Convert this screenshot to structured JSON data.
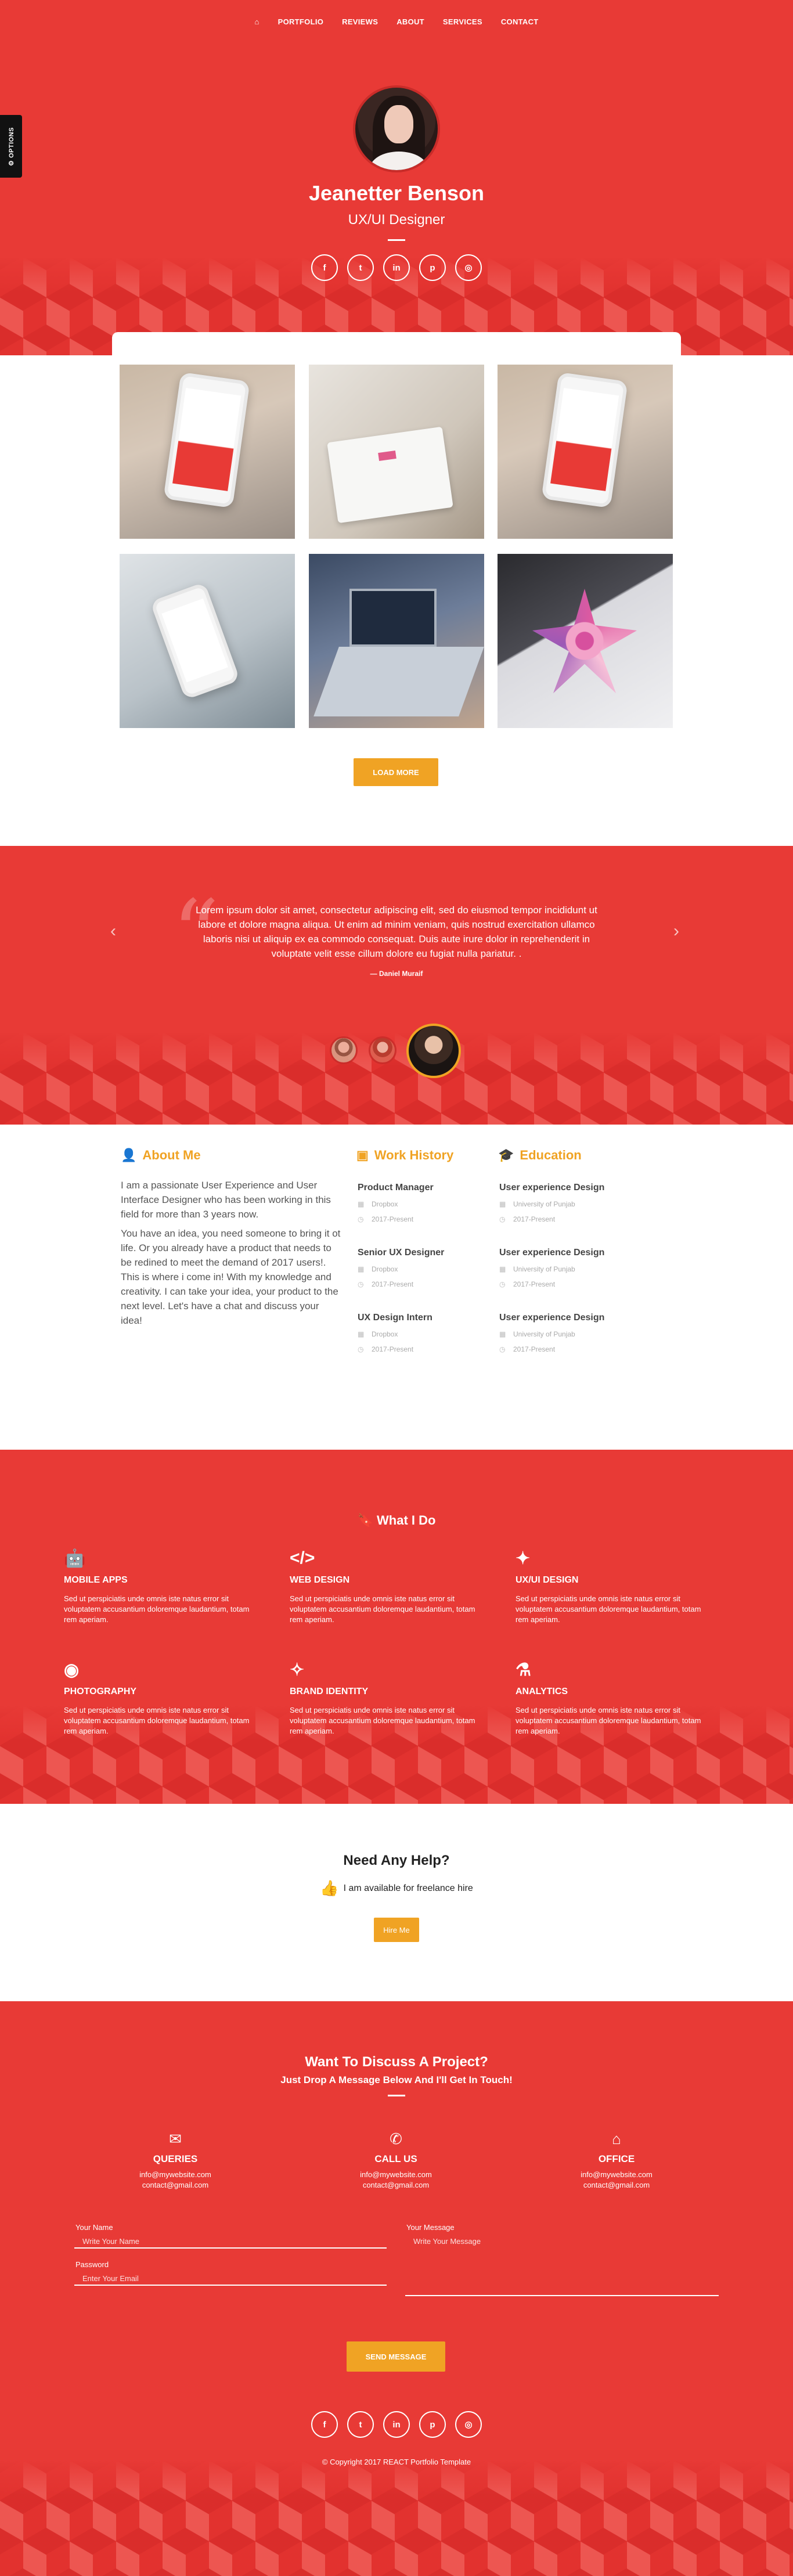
{
  "nav": {
    "home_icon": "home-icon",
    "items": [
      "PORTFOLIO",
      "REVIEWS",
      "ABOUT",
      "SERVICES",
      "CONTACT"
    ]
  },
  "options_tab": {
    "label": "OPTIONS",
    "icon": "gear-icon"
  },
  "hero": {
    "name": "Jeanetter Benson",
    "role": "UX/UI Designer",
    "socials": [
      {
        "icon": "facebook-icon",
        "glyph": "f"
      },
      {
        "icon": "twitter-icon",
        "glyph": "t"
      },
      {
        "icon": "linkedin-icon",
        "glyph": "in"
      },
      {
        "icon": "pinterest-icon",
        "glyph": "p"
      },
      {
        "icon": "instagram-icon",
        "glyph": "◎"
      }
    ]
  },
  "portfolio": {
    "tiles": [
      "mobile-app-screenshot",
      "tablet-sketch",
      "mobile-app-screenshot",
      "phone-in-hand",
      "laptop-workspace",
      "tablet-artwork"
    ],
    "load_more_label": "LOAD MORE"
  },
  "testimonial": {
    "quote": "Lorem ipsum dolor sit amet, consectetur adipiscing elit, sed do eiusmod tempor incididunt ut labore et dolore magna aliqua. Ut enim ad minim veniam, quis nostrud exercitation ullamco laboris nisi ut aliquip ex ea commodo consequat. Duis aute irure dolor in reprehenderit in voluptate velit esse cillum dolore eu fugiat nulla pariatur. .",
    "author": "— Daniel Muraif",
    "prev_icon": "chevron-left-icon",
    "next_icon": "chevron-right-icon"
  },
  "about": {
    "title": "About Me",
    "paragraphs": [
      "I am a passionate User Experience and User Interface Designer who has been working in this field for more than 3 years now.",
      "You have an idea, you need someone to bring it ot life. Or you already have a product that needs to be redined to meet the demand of 2017 users!. This is where i come in! With my knowledge and creativity. I can take your idea, your product to the next level. Let's have a chat and discuss your idea!"
    ]
  },
  "work_history": {
    "title": "Work History",
    "items": [
      {
        "title": "Product Manager",
        "company": "Dropbox",
        "period": "2017-Present"
      },
      {
        "title": "Senior UX Designer",
        "company": "Dropbox",
        "period": "2017-Present"
      },
      {
        "title": "UX Design Intern",
        "company": "Dropbox",
        "period": "2017-Present"
      }
    ]
  },
  "education": {
    "title": "Education",
    "items": [
      {
        "title": "User experience Design",
        "school": "University of Punjab",
        "period": "2017-Present"
      },
      {
        "title": "User experience Design",
        "school": "University of Punjab",
        "period": "2017-Present"
      },
      {
        "title": "User experience Design",
        "school": "University of Punjab",
        "period": "2017-Present"
      }
    ]
  },
  "services": {
    "title": "What I Do",
    "items": [
      {
        "icon": "android-icon",
        "glyph": "🤖",
        "name": "MOBILE APPS",
        "desc": "Sed ut perspiciatis unde omnis iste natus error sit voluptatem accusantium doloremque laudantium, totam rem aperiam."
      },
      {
        "icon": "code-icon",
        "glyph": "</>",
        "name": "WEB DESIGN",
        "desc": "Sed ut perspiciatis unde omnis iste natus error sit voluptatem accusantium doloremque laudantium, totam rem aperiam."
      },
      {
        "icon": "magic-wand-icon",
        "glyph": "✦",
        "name": "UX/UI DESIGN",
        "desc": "Sed ut perspiciatis unde omnis iste natus error sit voluptatem accusantium doloremque laudantium, totam rem aperiam."
      },
      {
        "icon": "camera-icon",
        "glyph": "◉",
        "name": "PHOTOGRAPHY",
        "desc": "Sed ut perspiciatis unde omnis iste natus error sit voluptatem accusantium doloremque laudantium, totam rem aperiam."
      },
      {
        "icon": "lightbulb-icon",
        "glyph": "✧",
        "name": "BRAND IDENTITY",
        "desc": "Sed ut perspiciatis unde omnis iste natus error sit voluptatem accusantium doloremque laudantium, totam rem aperiam."
      },
      {
        "icon": "flask-icon",
        "glyph": "⚗",
        "name": "ANALYTICS",
        "desc": "Sed ut perspiciatis unde omnis iste natus error sit voluptatem accusantium doloremque laudantium, totam rem aperiam."
      }
    ]
  },
  "help": {
    "title": "Need Any Help?",
    "subtitle": "I am available for freelance hire",
    "thumb_icon": "thumbs-up-icon",
    "button_label": "Hire Me"
  },
  "contact": {
    "title": "Want To Discuss A Project?",
    "subtitle": "Just Drop A Message Below And I'll Get In Touch!",
    "columns": [
      {
        "icon": "envelope-icon",
        "glyph": "✉",
        "heading": "QUERIES",
        "line1": "info@mywebsite.com",
        "line2": "contact@gmail.com"
      },
      {
        "icon": "phone-icon",
        "glyph": "✆",
        "heading": "CALL US",
        "line1": "info@mywebsite.com",
        "line2": "contact@gmail.com"
      },
      {
        "icon": "home-icon",
        "glyph": "⌂",
        "heading": "OFFICE",
        "line1": "info@mywebsite.com",
        "line2": "contact@gmail.com"
      }
    ],
    "form": {
      "name_label": "Your Name",
      "name_placeholder": "Write Your Name",
      "password_label": "Password",
      "password_placeholder": "Enter Your Email",
      "message_label": "Your Message",
      "message_placeholder": "Write Your Message",
      "send_label": "SEND MESSAGE"
    },
    "copyright": "© Copyright 2017 REACT Portfolio Template"
  },
  "colors": {
    "brand_red": "#e83a36",
    "accent_orange": "#f0a324"
  }
}
